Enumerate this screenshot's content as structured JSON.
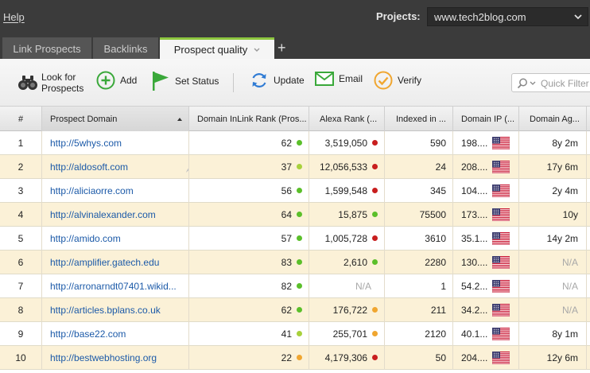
{
  "menu": {
    "help": "Help"
  },
  "projects": {
    "label": "Projects:",
    "selected": "www.tech2blog.com"
  },
  "tabs": [
    {
      "label": "Link Prospects"
    },
    {
      "label": "Backlinks"
    },
    {
      "label": "Prospect quality"
    }
  ],
  "toolbar": {
    "look_for_line1": "Look for",
    "look_for_line2": "Prospects",
    "add": "Add",
    "set_status": "Set Status",
    "update": "Update",
    "email": "Email",
    "verify": "Verify",
    "filter_placeholder": "Quick Filter"
  },
  "table": {
    "columns": [
      "#",
      "Prospect Domain",
      "Domain InLink Rank (Pros...",
      "Alexa Rank (...",
      "Indexed in ...",
      "Domain IP (...",
      "Domain Ag..."
    ],
    "rows": [
      {
        "num": "1",
        "domain": "http://5whys.com",
        "inlink": "62",
        "inlink_color": "#5bbf2a",
        "alexa": "3,519,050",
        "alexa_color": "#c81e1e",
        "indexed": "590",
        "ip": "198....",
        "age": "8y 2m"
      },
      {
        "num": "2",
        "domain": "http://aldosoft.com",
        "inlink": "37",
        "inlink_color": "#a8d13c",
        "alexa": "12,056,533",
        "alexa_color": "#c81e1e",
        "indexed": "24",
        "ip": "208....",
        "age": "17y 6m"
      },
      {
        "num": "3",
        "domain": "http://aliciaorre.com",
        "inlink": "56",
        "inlink_color": "#5bbf2a",
        "alexa": "1,599,548",
        "alexa_color": "#c81e1e",
        "indexed": "345",
        "ip": "104....",
        "age": "2y 4m"
      },
      {
        "num": "4",
        "domain": "http://alvinalexander.com",
        "inlink": "64",
        "inlink_color": "#5bbf2a",
        "alexa": "15,875",
        "alexa_color": "#5bbf2a",
        "indexed": "75500",
        "ip": "173....",
        "age": "10y"
      },
      {
        "num": "5",
        "domain": "http://amido.com",
        "inlink": "57",
        "inlink_color": "#5bbf2a",
        "alexa": "1,005,728",
        "alexa_color": "#c81e1e",
        "indexed": "3610",
        "ip": "35.1...",
        "age": "14y 2m"
      },
      {
        "num": "6",
        "domain": "http://amplifier.gatech.edu",
        "inlink": "83",
        "inlink_color": "#5bbf2a",
        "alexa": "2,610",
        "alexa_color": "#5bbf2a",
        "indexed": "2280",
        "ip": "130....",
        "age": "N/A"
      },
      {
        "num": "7",
        "domain": "http://arronarndt07401.wikid...",
        "inlink": "82",
        "inlink_color": "#5bbf2a",
        "alexa": "N/A",
        "alexa_color": "",
        "indexed": "1",
        "ip": "54.2...",
        "age": "N/A"
      },
      {
        "num": "8",
        "domain": "http://articles.bplans.co.uk",
        "inlink": "62",
        "inlink_color": "#5bbf2a",
        "alexa": "176,722",
        "alexa_color": "#f0a630",
        "indexed": "211",
        "ip": "34.2...",
        "age": "N/A"
      },
      {
        "num": "9",
        "domain": "http://base22.com",
        "inlink": "41",
        "inlink_color": "#a8d13c",
        "alexa": "255,701",
        "alexa_color": "#f0a630",
        "indexed": "2120",
        "ip": "40.1...",
        "age": "8y 1m"
      },
      {
        "num": "10",
        "domain": "http://bestwebhosting.org",
        "inlink": "22",
        "inlink_color": "#f0a630",
        "alexa": "4,179,306",
        "alexa_color": "#c81e1e",
        "indexed": "50",
        "ip": "204....",
        "age": "12y 6m"
      }
    ]
  }
}
